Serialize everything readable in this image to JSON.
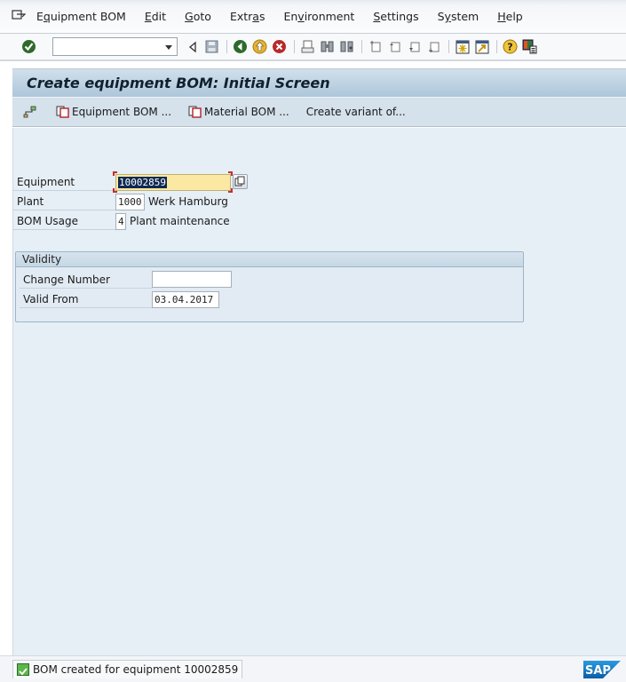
{
  "menubar": {
    "items": [
      {
        "label": "Equipment BOM",
        "mnemonic_index": 1
      },
      {
        "label": "Edit",
        "mnemonic_index": 0
      },
      {
        "label": "Goto",
        "mnemonic_index": 0
      },
      {
        "label": "Extras",
        "mnemonic_index": 4
      },
      {
        "label": "Environment",
        "mnemonic_index": 2
      },
      {
        "label": "Settings",
        "mnemonic_index": 0
      },
      {
        "label": "System",
        "mnemonic_index": 1
      },
      {
        "label": "Help",
        "mnemonic_index": 0
      }
    ]
  },
  "toolbar": {
    "command_field": {
      "value": "",
      "placeholder": ""
    },
    "icons": [
      "enter-icon",
      "back-arrow-icon",
      "save-icon",
      "back-icon",
      "exit-icon",
      "cancel-icon",
      "print-icon",
      "find-icon",
      "find-next-icon",
      "first-page-icon",
      "previous-page-icon",
      "next-page-icon",
      "last-page-icon",
      "create-session-icon",
      "shortcut-icon",
      "help-icon",
      "customize-layout-icon"
    ]
  },
  "title": "Create equipment BOM: Initial Screen",
  "app_toolbar": {
    "buttons": [
      {
        "label": "",
        "icon": "hierarchy-icon"
      },
      {
        "label": "Equipment BOM ...",
        "icon": "copy-icon"
      },
      {
        "label": "Material BOM ...",
        "icon": "copy-icon"
      },
      {
        "label": "Create variant of...",
        "icon": ""
      }
    ]
  },
  "form": {
    "equipment": {
      "label": "Equipment",
      "value": "10002859"
    },
    "plant": {
      "label": "Plant",
      "value": "1000",
      "description": "Werk Hamburg"
    },
    "bom_usage": {
      "label": "BOM Usage",
      "value": "4",
      "description": "Plant maintenance"
    }
  },
  "validity": {
    "title": "Validity",
    "change_number": {
      "label": "Change Number",
      "value": ""
    },
    "valid_from": {
      "label": "Valid From",
      "value": "03.04.2017"
    }
  },
  "status": {
    "message": "BOM created for equipment 10002859",
    "type": "success"
  },
  "brand": {
    "logo": "SAP",
    "colors": {
      "logo_blue": "#1f7fc4",
      "title_bg": "#b6cde0",
      "content_bg": "#e6eef6"
    }
  }
}
